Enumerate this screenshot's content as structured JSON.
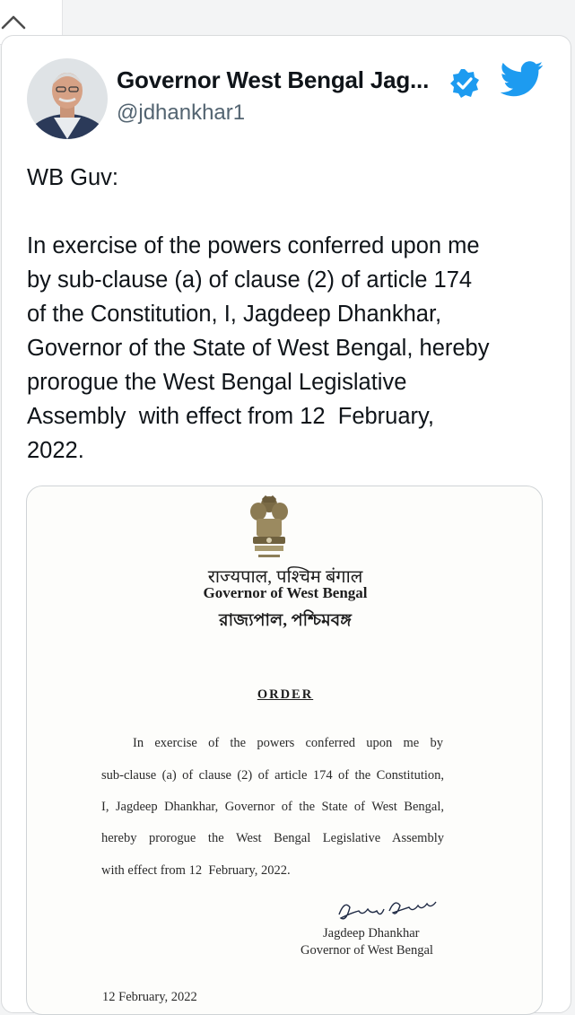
{
  "tweet": {
    "author_name": "Governor West Bengal Jag...",
    "handle": "@jdhankhar1",
    "intro": "WB Guv:",
    "body_lines": [
      "In exercise of the powers conferred upon me",
      "by sub-clause (a) of clause (2) of article 174",
      "of the Constitution, I, Jagdeep Dhankhar,",
      "Governor of the State of West Bengal, hereby",
      "prorogue the West Bengal Legislative",
      "Assembly  with effect from 12  February,",
      "2022."
    ]
  },
  "document": {
    "header_hindi": "राज्यपाल, पश्चिम बंगाल",
    "header_english": "Governor of West Bengal",
    "header_bengali": "রাজ্যপাল, পশ্চিমবঙ্গ",
    "title": "ORDER",
    "body_lines": [
      "In exercise of the powers conferred upon me by",
      "sub-clause (a) of clause (2) of article 174 of the Constitution,",
      "I, Jagdeep Dhankhar, Governor of the State of West Bengal,",
      "hereby prorogue the West Bengal Legislative Assembly",
      "with effect from 12  February, 2022."
    ],
    "signatory_name": "Jagdeep Dhankhar",
    "signatory_title": "Governor of West Bengal",
    "date": "12 February, 2022"
  },
  "colors": {
    "twitter_blue": "#1d9bf0",
    "text_primary": "#0f1419",
    "text_secondary": "#536471"
  },
  "icons": [
    "chevron-up-icon",
    "verified-badge-icon",
    "twitter-bird-icon"
  ]
}
